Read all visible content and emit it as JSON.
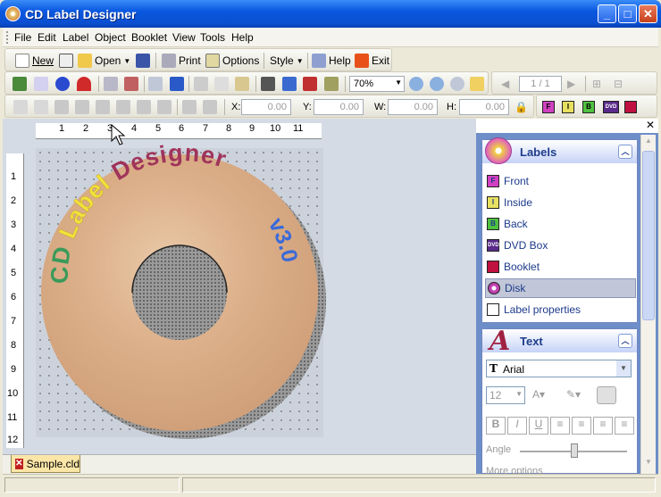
{
  "window": {
    "title": "CD Label Designer"
  },
  "menu": [
    "File",
    "Edit",
    "Label",
    "Object",
    "Booklet",
    "View",
    "Tools",
    "Help"
  ],
  "toolbar1": {
    "new": "New",
    "open": "Open",
    "print": "Print",
    "options": "Options",
    "style": "Style",
    "help": "Help",
    "exit": "Exit"
  },
  "toolbar2": {
    "zoom": "70%",
    "page": "1 / 1"
  },
  "toolbar3": {
    "x_label": "X:",
    "x_value": "0.00",
    "y_label": "Y:",
    "y_value": "0.00",
    "w_label": "W:",
    "w_value": "0.00",
    "h_label": "H:",
    "h_value": "0.00"
  },
  "ruler": {
    "h_ticks": [
      "1",
      "2",
      "3",
      "4",
      "5",
      "6",
      "7",
      "8",
      "9",
      "10",
      "11"
    ],
    "v_ticks": [
      "1",
      "2",
      "3",
      "4",
      "5",
      "6",
      "7",
      "8",
      "9",
      "10",
      "11",
      "12"
    ]
  },
  "disc": {
    "text_left": "CD Label Designer",
    "text_right": "v3.0",
    "colors": {
      "cd": "#3a9a5a",
      "label": "#f2e23a",
      "designer": "#a0345a",
      "version": "#3a6ad8"
    }
  },
  "doc_tab": {
    "name": "Sample.cld"
  },
  "labels_panel": {
    "title": "Labels",
    "items": [
      "Front",
      "Inside",
      "Back",
      "DVD Box",
      "Booklet",
      "Disk",
      "Label properties"
    ],
    "selected": "Disk"
  },
  "text_panel": {
    "title": "Text",
    "font": "Arial",
    "size": "12",
    "angle_label": "Angle",
    "more": "More options"
  }
}
